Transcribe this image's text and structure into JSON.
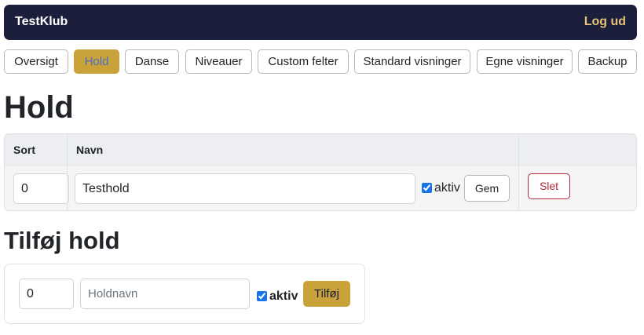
{
  "header": {
    "brand": "TestKlub",
    "logout_label": "Log ud"
  },
  "nav": {
    "items": [
      {
        "label": "Oversigt",
        "active": false
      },
      {
        "label": "Hold",
        "active": true
      },
      {
        "label": "Danse",
        "active": false
      },
      {
        "label": "Niveauer",
        "active": false
      },
      {
        "label": "Custom felter",
        "active": false
      },
      {
        "label": "Standard visninger",
        "active": false
      },
      {
        "label": "Egne visninger",
        "active": false
      },
      {
        "label": "Backup",
        "active": false
      }
    ]
  },
  "page": {
    "title": "Hold"
  },
  "table": {
    "columns": [
      "Sort",
      "Navn",
      ""
    ],
    "rows": [
      {
        "sort": "0",
        "name": "Testhold",
        "active": true,
        "active_label": "aktiv",
        "save_label": "Gem",
        "delete_label": "Slet"
      }
    ]
  },
  "add_form": {
    "title": "Tilføj hold",
    "sort_value": "0",
    "name_placeholder": "Holdnavn",
    "active": true,
    "active_label": "aktiv",
    "submit_label": "Tilføj"
  },
  "colors": {
    "header_bg": "#1b1f3b",
    "accent": "#c9a23a",
    "logout": "#e6c27a",
    "danger": "#b02a37"
  }
}
